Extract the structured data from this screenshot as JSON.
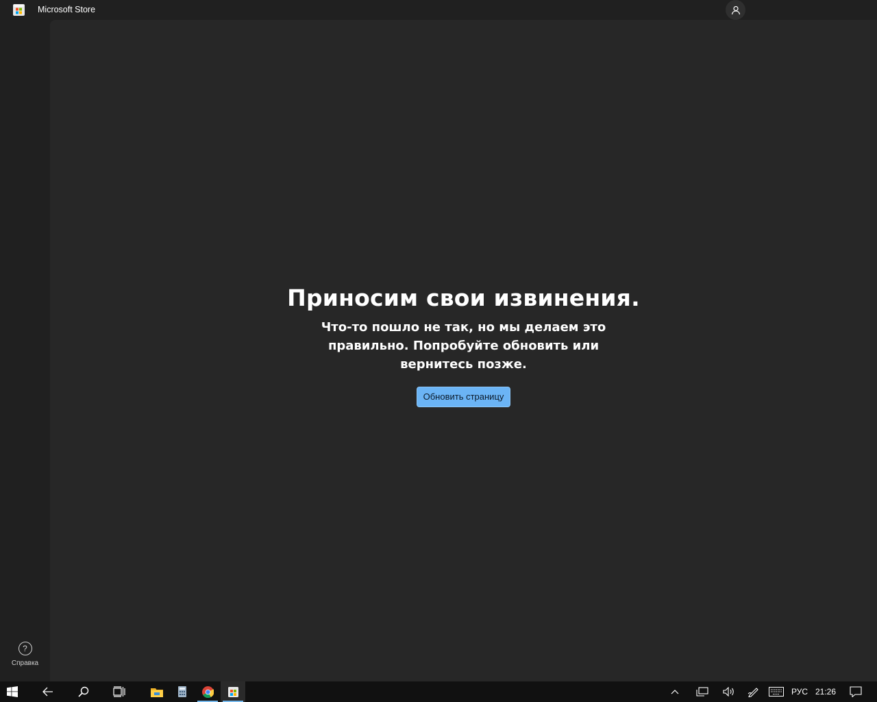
{
  "window": {
    "title": "Microsoft Store"
  },
  "error": {
    "title": "Приносим свои извинения.",
    "message": "Что-то пошло не так, но мы делаем это правильно. Попробуйте обновить или вернитесь позже.",
    "button_label": "Обновить страницу"
  },
  "sidebar": {
    "help_label": "Справка",
    "help_glyph": "?"
  },
  "taskbar": {
    "language": "РУС",
    "time": "21:26",
    "pinned": [
      "start-icon",
      "back-icon",
      "search-icon",
      "task-view-icon",
      "file-explorer-icon",
      "calculator-icon",
      "chrome-icon",
      "microsoft-store-icon"
    ]
  },
  "colors": {
    "accent": "#6bb4f5",
    "background": "#202020",
    "content_background": "#272727",
    "taskbar": "#111111"
  }
}
